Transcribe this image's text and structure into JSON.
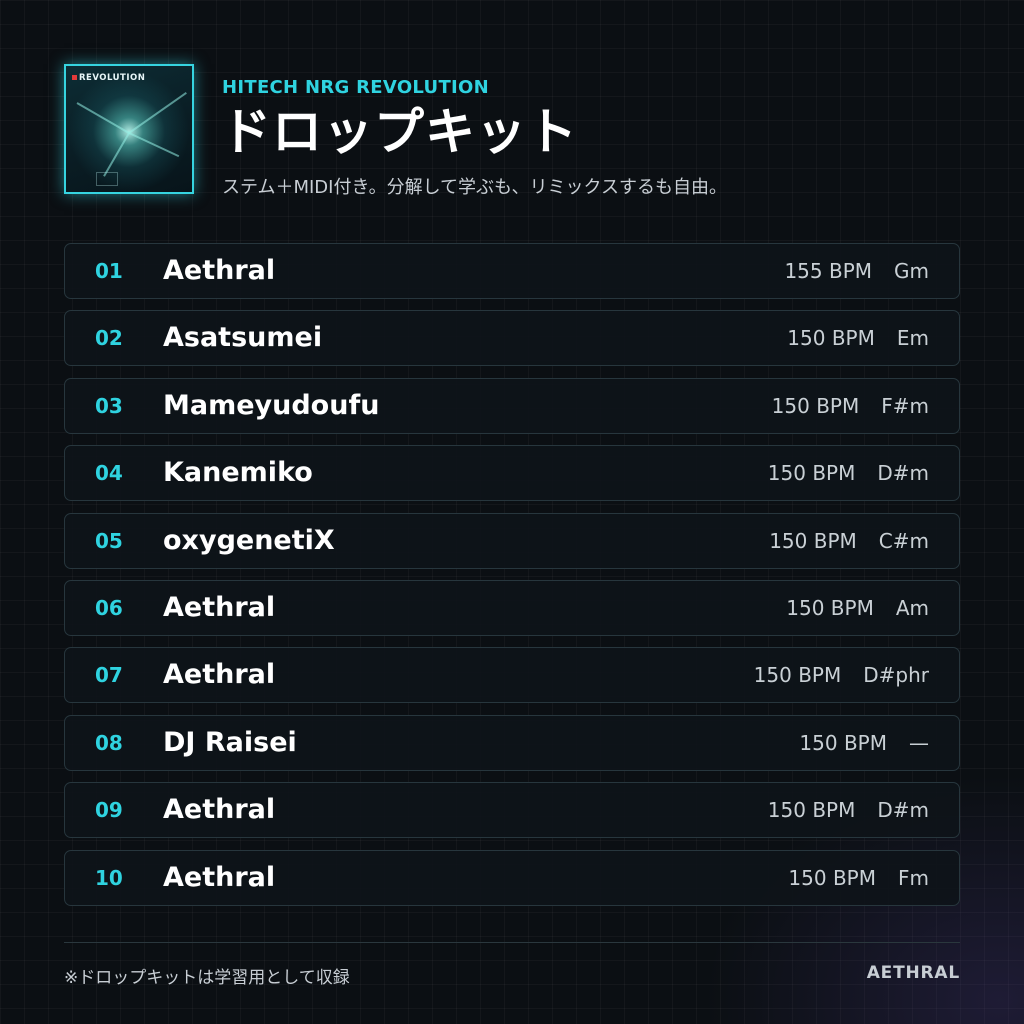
{
  "header": {
    "cover_art_text": "REVOLUTION",
    "eyebrow": "HITECH NRG REVOLUTION",
    "title": "ドロップキット",
    "subtitle": "ステム＋MIDI付き。分解して学ぶも、リミックスするも自由。"
  },
  "tracks": [
    {
      "number": "01",
      "artist": "Aethral",
      "bpm": "155 BPM",
      "key": "Gm"
    },
    {
      "number": "02",
      "artist": "Asatsumei",
      "bpm": "150 BPM",
      "key": "Em"
    },
    {
      "number": "03",
      "artist": "Mameyudoufu",
      "bpm": "150 BPM",
      "key": "F#m"
    },
    {
      "number": "04",
      "artist": "Kanemiko",
      "bpm": "150 BPM",
      "key": "D#m"
    },
    {
      "number": "05",
      "artist": "oxygenetiX",
      "bpm": "150 BPM",
      "key": "C#m"
    },
    {
      "number": "06",
      "artist": "Aethral",
      "bpm": "150 BPM",
      "key": "Am"
    },
    {
      "number": "07",
      "artist": "Aethral",
      "bpm": "150 BPM",
      "key": "D#phr"
    },
    {
      "number": "08",
      "artist": "DJ Raisei",
      "bpm": "150 BPM",
      "key": "—"
    },
    {
      "number": "09",
      "artist": "Aethral",
      "bpm": "150 BPM",
      "key": "D#m"
    },
    {
      "number": "10",
      "artist": "Aethral",
      "bpm": "150 BPM",
      "key": "Fm"
    }
  ],
  "footer": {
    "note": "※ドロップキットは学習用として収録",
    "brand": "AETHRAL"
  },
  "colors": {
    "accent": "#2fd3e0",
    "background": "#0b0f13",
    "row_background": "#0e1419",
    "row_border": "#27363d",
    "text_primary": "#ffffff",
    "text_secondary": "#c9d0d5"
  }
}
